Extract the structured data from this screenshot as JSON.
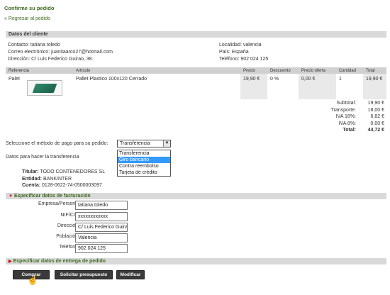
{
  "header": {
    "title": "Confirme su pedido",
    "back_link": "« Regresar al pedido"
  },
  "client": {
    "section_title": "Datos del cliente",
    "contacto": "Contacto: tatiana toledo",
    "correo": "Correo electrónico: juanitaarco27@hotmail.com",
    "direccion": "Dirección: C/ Luis Federico Guirao, 38.",
    "localidad": "Localidad: valencia",
    "pais": "País: España",
    "telefono": "Teléfono: 902 024 125"
  },
  "table": {
    "headers": [
      "Referencia",
      "Artículo",
      "Precio",
      "Descuento",
      "Precio oferta",
      "Cantidad",
      "Total"
    ],
    "rows": [
      {
        "referencia": "Palet",
        "articulo": "Pallet Plastico 100x120 Cerrado",
        "precio": "19,90 €",
        "descuento": "0 %",
        "precio_oferta": "0,00 €",
        "cantidad": "1",
        "total": "19,90 €"
      }
    ]
  },
  "totals": {
    "subtotal_label": "Subtotal:",
    "subtotal": "19,90 €",
    "transporte_label": "Transporte:",
    "transporte": "18,00 €",
    "iva18_label": "IVA 18%:",
    "iva18": "6,82 €",
    "iva8_label": "IVA 8%:",
    "iva8": "0,00 €",
    "total_label": "Total:",
    "total": "44,72 €"
  },
  "payment": {
    "label": "Seleccione el método de pago para su pedido:",
    "selected": "Transferencia",
    "options": [
      "Transferencia",
      "Giro bancario",
      "Contra reembolso",
      "Tarjeta de crédito"
    ],
    "highlighted_index": 1,
    "transfer_label": "Datos para hacer la transferencia"
  },
  "bank": {
    "titular_label": "Titular:",
    "titular": "TODO CONTENEDORES SL",
    "entidad_label": "Entidad:",
    "entidad": "BANKINTER",
    "cuenta_label": "Cuenta:",
    "cuenta": "0128-0622-74-0500003097"
  },
  "billing": {
    "section_title": "Especificar datos de facturación",
    "fields": [
      {
        "label": "Empresa/Persona:",
        "value": "tatiana toledo"
      },
      {
        "label": "NIF/CIF:",
        "value": "xxxxxxxxxxxx"
      },
      {
        "label": "Dirección:",
        "value": "C/ Luis Federico Guira"
      },
      {
        "label": "Población:",
        "value": "Valencia"
      },
      {
        "label": "Teléfono:",
        "value": "902 024 125"
      }
    ]
  },
  "shipping": {
    "section_title": "Especificar datos de entrega de pedido"
  },
  "buttons": {
    "comprar": "Comprar",
    "presupuesto": "Solicitar presupuesto",
    "modificar": "Modificar"
  }
}
